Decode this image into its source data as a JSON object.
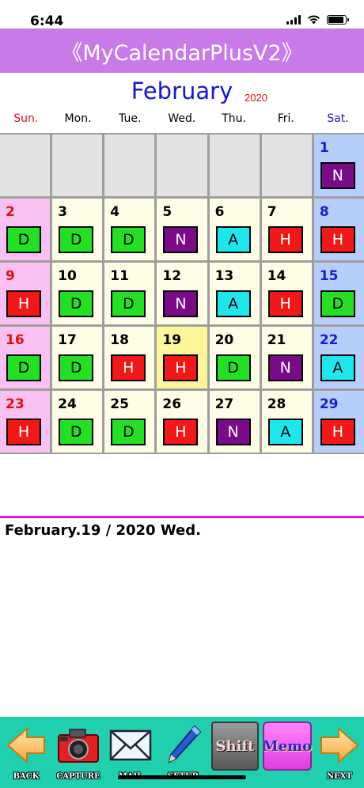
{
  "status_bar": {
    "time": "6:44",
    "battery_level": 0.9
  },
  "header": {
    "title": "《MyCalendarPlusV2》"
  },
  "calendar": {
    "month": "February",
    "year": "2020",
    "weekdays": [
      "Sun.",
      "Mon.",
      "Tue.",
      "Wed.",
      "Thu.",
      "Fri.",
      "Sat."
    ],
    "shift_colors": {
      "D": "#22e022",
      "N": "#7a0a8a",
      "A": "#1ee6ee",
      "H": "#f21818"
    },
    "weeks": [
      [
        {
          "day": "",
          "shift": ""
        },
        {
          "day": "",
          "shift": ""
        },
        {
          "day": "",
          "shift": ""
        },
        {
          "day": "",
          "shift": ""
        },
        {
          "day": "",
          "shift": ""
        },
        {
          "day": "",
          "shift": ""
        },
        {
          "day": "1",
          "shift": "N"
        }
      ],
      [
        {
          "day": "2",
          "shift": "D"
        },
        {
          "day": "3",
          "shift": "D"
        },
        {
          "day": "4",
          "shift": "D"
        },
        {
          "day": "5",
          "shift": "N"
        },
        {
          "day": "6",
          "shift": "A"
        },
        {
          "day": "7",
          "shift": "H"
        },
        {
          "day": "8",
          "shift": "H"
        }
      ],
      [
        {
          "day": "9",
          "shift": "H"
        },
        {
          "day": "10",
          "shift": "D"
        },
        {
          "day": "11",
          "shift": "D"
        },
        {
          "day": "12",
          "shift": "N"
        },
        {
          "day": "13",
          "shift": "A"
        },
        {
          "day": "14",
          "shift": "H"
        },
        {
          "day": "15",
          "shift": "D"
        }
      ],
      [
        {
          "day": "16",
          "shift": "D"
        },
        {
          "day": "17",
          "shift": "D"
        },
        {
          "day": "18",
          "shift": "H"
        },
        {
          "day": "19",
          "shift": "H",
          "today": true
        },
        {
          "day": "20",
          "shift": "D"
        },
        {
          "day": "21",
          "shift": "N"
        },
        {
          "day": "22",
          "shift": "A"
        }
      ],
      [
        {
          "day": "23",
          "shift": "H"
        },
        {
          "day": "24",
          "shift": "D"
        },
        {
          "day": "25",
          "shift": "D"
        },
        {
          "day": "26",
          "shift": "H"
        },
        {
          "day": "27",
          "shift": "N"
        },
        {
          "day": "28",
          "shift": "A"
        },
        {
          "day": "29",
          "shift": "H"
        }
      ]
    ]
  },
  "selection": {
    "date_text": "February.19 / 2020 Wed."
  },
  "toolbar": {
    "back_label": "BACK",
    "capture_label": "CAPTURE",
    "mail_label": "MAIL",
    "setup_label": "SETUP",
    "shift_label": "Shift",
    "memo_label": "Memo",
    "next_label": "NEXT"
  }
}
